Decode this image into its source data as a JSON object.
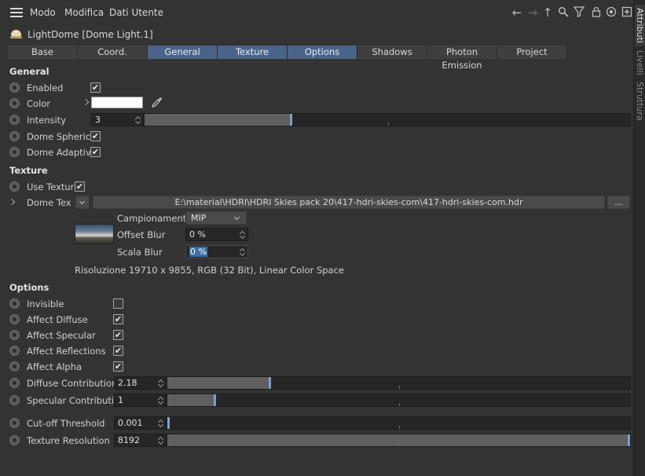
{
  "menu": {
    "items": [
      "Modo",
      "Modifica",
      "Dati Utente"
    ]
  },
  "side_tabs": [
    "Attributi",
    "Livelli",
    "Struttura"
  ],
  "object": {
    "title": "LightDome [Dome Light.1]"
  },
  "tabs": [
    {
      "label": "Base",
      "selected": false
    },
    {
      "label": "Coord.",
      "selected": false
    },
    {
      "label": "General",
      "selected": true
    },
    {
      "label": "Texture",
      "selected": true
    },
    {
      "label": "Options",
      "selected": true
    },
    {
      "label": "Shadows",
      "selected": false
    },
    {
      "label": "Photon Emission",
      "selected": false
    },
    {
      "label": "Project",
      "selected": false
    }
  ],
  "general": {
    "heading": "General",
    "enabled_label": "Enabled",
    "enabled": true,
    "color_label": "Color",
    "color_value": "#ffffff",
    "intensity_label": "Intensity",
    "intensity_value": "3",
    "intensity_fraction": 0.3,
    "dome_spherical_label": "Dome Spherical",
    "dome_spherical": true,
    "dome_adaptive_label": "Dome Adaptive",
    "dome_adaptive": true
  },
  "texture": {
    "heading": "Texture",
    "use_texture_label": "Use Texture",
    "use_texture": true,
    "dome_tex_label": "Dome Tex",
    "dome_tex_path": "E:\\material\\HDRI\\HDRI Skies pack 20\\417-hdri-skies-com\\417-hdri-skies-com.hdr",
    "browse_label": "...",
    "sampling_label": "Campionamento",
    "sampling_value": "MIP",
    "offset_blur_label": "Offset Blur",
    "offset_blur_value": "0 %",
    "scale_blur_label": "Scala Blur",
    "scale_blur_value": "0 %",
    "resolution_info": "Risoluzione 19710 x 9855, RGB (32 Bit), Linear Color Space"
  },
  "options": {
    "heading": "Options",
    "invisible_label": "Invisible",
    "invisible": false,
    "affect_diffuse_label": "Affect Diffuse",
    "affect_diffuse": true,
    "affect_specular_label": "Affect Specular",
    "affect_specular": true,
    "affect_reflections_label": "Affect Reflections",
    "affect_reflections": true,
    "affect_alpha_label": "Affect Alpha",
    "affect_alpha": true,
    "diffuse_contribution_label": "Diffuse Contribution",
    "diffuse_contribution_value": "2.18",
    "diffuse_contribution_fraction": 0.22,
    "specular_contribution_label": "Specular Contribution",
    "specular_contribution_value": "1",
    "specular_contribution_fraction": 0.1,
    "cutoff_label": "Cut-off Threshold",
    "cutoff_value": "0.001",
    "cutoff_fraction": 0.0,
    "texture_resolution_label": "Texture Resolution",
    "texture_resolution_value": "8192",
    "texture_resolution_fraction": 1.0
  },
  "colors": {
    "accent_tab": "#4a6489",
    "slider_knob": "#7c9fd3"
  }
}
